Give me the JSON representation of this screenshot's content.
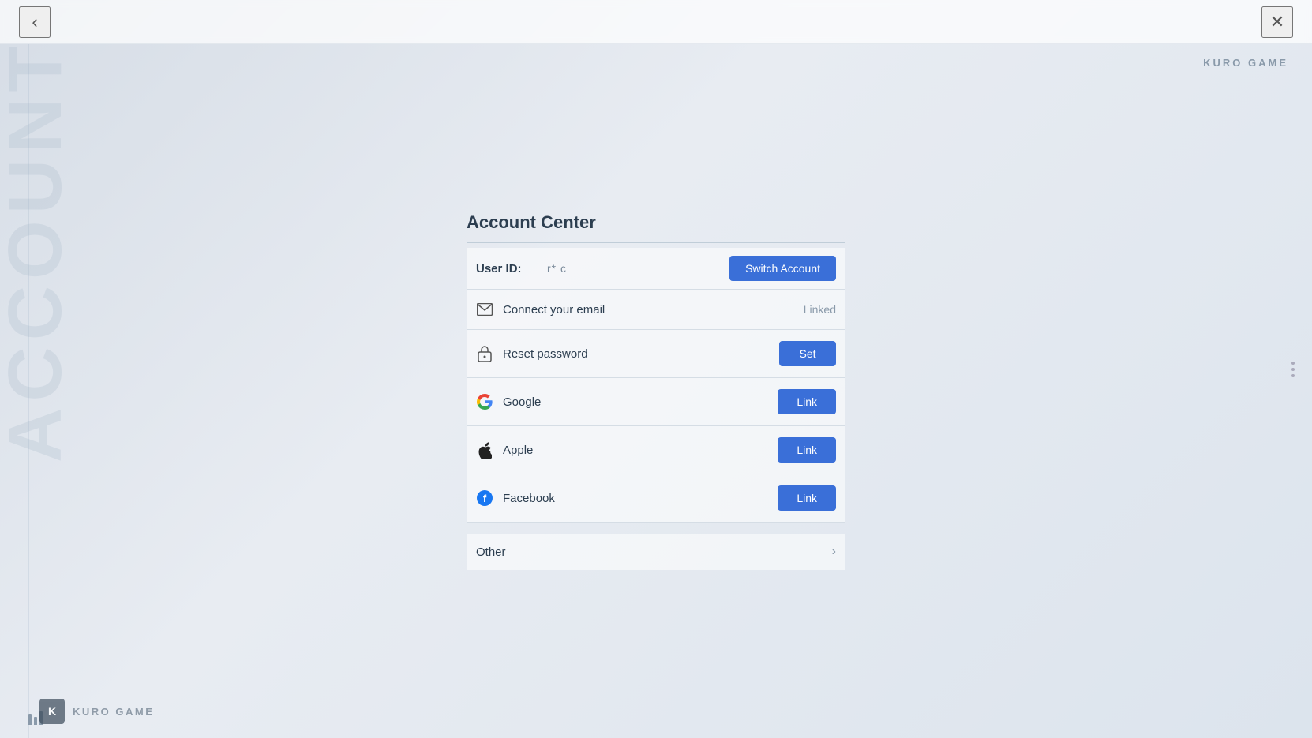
{
  "topbar": {
    "back_label": "‹",
    "close_label": "✕"
  },
  "brand": {
    "name": "KURO GAME",
    "watermark": "ACCOUNT"
  },
  "account_center": {
    "title": "Account Center",
    "user_id": {
      "label": "User ID:",
      "value": "r* c",
      "switch_button": "Switch Account"
    },
    "rows": [
      {
        "id": "email",
        "icon": "email",
        "label": "Connect your email",
        "action_type": "status",
        "action_label": "Linked"
      },
      {
        "id": "password",
        "icon": "lock",
        "label": "Reset password",
        "action_type": "button",
        "action_label": "Set"
      },
      {
        "id": "google",
        "icon": "google",
        "label": "Google",
        "action_type": "button",
        "action_label": "Link"
      },
      {
        "id": "apple",
        "icon": "apple",
        "label": "Apple",
        "action_type": "button",
        "action_label": "Link"
      },
      {
        "id": "facebook",
        "icon": "facebook",
        "label": "Facebook",
        "action_type": "button",
        "action_label": "Link"
      }
    ],
    "other": {
      "label": "Other"
    }
  },
  "bottom_brand": {
    "icon_text": "K",
    "name": "KURO GAME"
  },
  "colors": {
    "accent": "#3a6fd8"
  }
}
